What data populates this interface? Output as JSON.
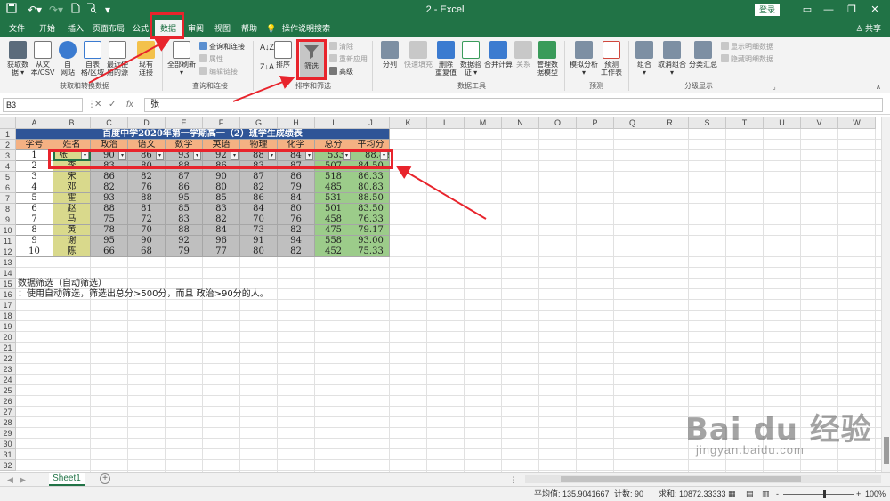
{
  "window": {
    "title": "2 - Excel",
    "login_label": "登录",
    "share_label": "共享",
    "quick_access": [
      "save-icon",
      "undo-icon",
      "redo-icon",
      "new-file-icon",
      "print-preview-icon",
      "customize-icon"
    ]
  },
  "tabs": [
    {
      "label": "文件",
      "active": false
    },
    {
      "label": "开始",
      "active": false
    },
    {
      "label": "插入",
      "active": false
    },
    {
      "label": "页面布局",
      "active": false
    },
    {
      "label": "公式",
      "active": false
    },
    {
      "label": "数据",
      "active": true
    },
    {
      "label": "审阅",
      "active": false
    },
    {
      "label": "视图",
      "active": false
    },
    {
      "label": "帮助",
      "active": false
    },
    {
      "label": "操作说明搜索",
      "active": false
    }
  ],
  "ribbon": {
    "get_data": {
      "btn1": "获取数\n据 ▾",
      "btn2": "从文\n本/CSV",
      "btn3": "自\n网站",
      "btn4": "自表\n格/区域",
      "btn5": "最近使\n用的源",
      "btn6": "现有\n连接",
      "group": "获取和转换数据"
    },
    "queries": {
      "refresh": "全部刷新\n▾",
      "queries_connections": "查询和连接",
      "properties": "属性",
      "edit_links": "编辑链接",
      "group": "查询和连接"
    },
    "sort_filter": {
      "sort": "排序",
      "filter": "筛选",
      "clear": "清除",
      "reapply": "重新应用",
      "advanced": "高级",
      "group": "排序和筛选"
    },
    "data_tools": {
      "split": "分列",
      "flash_fill": "快速填充",
      "remove_dup": "删除\n重复值",
      "validation": "数据验\n证 ▾",
      "consolidate": "合并计算",
      "relationships": "关系",
      "data_model": "管理数\n据模型",
      "group": "数据工具"
    },
    "forecast": {
      "whatif": "模拟分析\n▾",
      "sheet": "预测\n工作表",
      "group": "预测"
    },
    "outline": {
      "group_btn": "组合\n▾",
      "ungroup": "取消组合\n▾",
      "subtotal": "分类汇总",
      "show_detail": "显示明细数据",
      "hide_detail": "隐藏明细数据",
      "group": "分级显示"
    }
  },
  "formula_bar": {
    "name_box": "B3",
    "fx": "fx",
    "value": "张"
  },
  "columns": [
    "A",
    "B",
    "C",
    "D",
    "E",
    "F",
    "G",
    "H",
    "I",
    "J",
    "K",
    "L",
    "M",
    "N",
    "O",
    "P",
    "Q",
    "R",
    "S",
    "T",
    "U",
    "V",
    "W"
  ],
  "rows": [
    "1",
    "2",
    "3",
    "4",
    "5",
    "6",
    "7",
    "8",
    "9",
    "10",
    "11",
    "12",
    "13",
    "14",
    "15",
    "16",
    "17",
    "18",
    "19",
    "20",
    "21",
    "22",
    "23",
    "24",
    "25",
    "26",
    "27",
    "28",
    "29",
    "30",
    "31",
    "32"
  ],
  "sheet": {
    "title": "百度中学2020年第一学期高一（2）班学生成绩表",
    "headers": [
      "学号",
      "姓名",
      "政治",
      "语文",
      "数学",
      "英语",
      "物理",
      "化学",
      "总分",
      "平均分"
    ],
    "records": [
      [
        "1",
        "张",
        "90",
        "86",
        "93",
        "92",
        "88",
        "84",
        "533",
        "88.83"
      ],
      [
        "2",
        "李",
        "83",
        "80",
        "88",
        "86",
        "83",
        "87",
        "507",
        "84.50"
      ],
      [
        "3",
        "宋",
        "86",
        "82",
        "87",
        "90",
        "87",
        "86",
        "518",
        "86.33"
      ],
      [
        "4",
        "邓",
        "82",
        "76",
        "86",
        "80",
        "82",
        "79",
        "485",
        "80.83"
      ],
      [
        "5",
        "霍",
        "93",
        "88",
        "95",
        "85",
        "86",
        "84",
        "531",
        "88.50"
      ],
      [
        "6",
        "赵",
        "88",
        "81",
        "85",
        "83",
        "84",
        "80",
        "501",
        "83.50"
      ],
      [
        "7",
        "马",
        "75",
        "72",
        "83",
        "82",
        "70",
        "76",
        "458",
        "76.33"
      ],
      [
        "8",
        "黄",
        "78",
        "70",
        "88",
        "84",
        "73",
        "82",
        "475",
        "79.17"
      ],
      [
        "9",
        "谢",
        "95",
        "90",
        "92",
        "96",
        "91",
        "94",
        "558",
        "93.00"
      ],
      [
        "10",
        "陈",
        "66",
        "68",
        "79",
        "77",
        "80",
        "82",
        "452",
        "75.33"
      ]
    ],
    "note1": "数据筛选（自动筛选）",
    "note2": "：使用自动筛选，筛选出总分>500分，而且 政治>90分的人。"
  },
  "sheet_tabs": {
    "active": "Sheet1",
    "add": "+"
  },
  "status": {
    "average": "平均值: 135.9041667",
    "count": "计数: 90",
    "sum": "求和: 10872.33333",
    "zoom": "100%",
    "minus": "-",
    "plus": "+"
  },
  "watermark": {
    "text": "Bai du 经验",
    "sub": "jingyan.baidu.com"
  },
  "colors": {
    "excel_green": "#217346",
    "title_fill": "#2f5597",
    "header_fill": "#f4b183",
    "name_fill": "#d9d98c",
    "score_fill": "#bfbfbf",
    "total_fill": "#9ccc8a",
    "annotation_red": "#e8242c"
  }
}
